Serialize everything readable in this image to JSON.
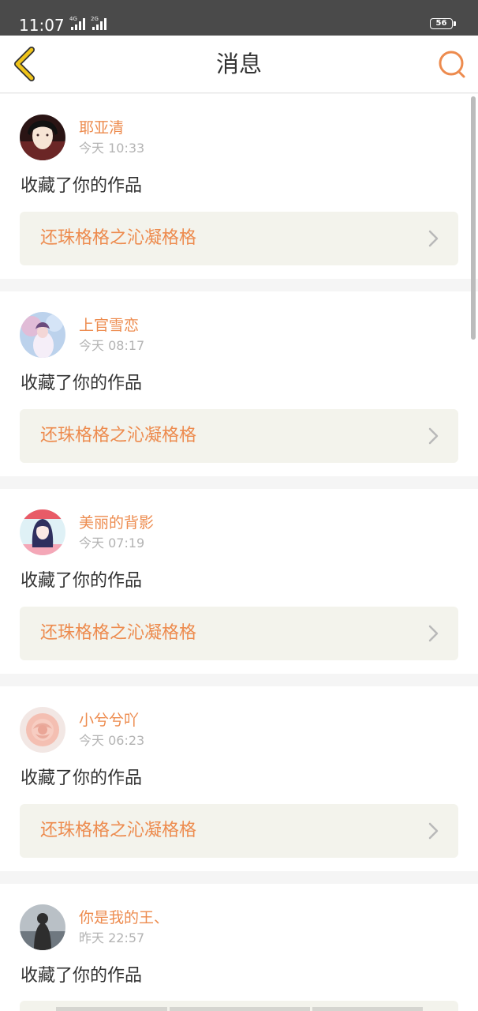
{
  "status_bar": {
    "time": "11:07",
    "network_1": "4G",
    "network_2": "2G",
    "battery": "56"
  },
  "header": {
    "title": "消息",
    "back_icon": "chevron-left-icon",
    "search_icon": "search-icon"
  },
  "colors": {
    "accent": "#ed8b4e",
    "back_icon": "#f0c419",
    "link_background": "#f3f3ec"
  },
  "messages": [
    {
      "user": "耶亚清",
      "time": "今天 10:33",
      "action": "收藏了你的作品",
      "work": "还珠格格之沁凝格格"
    },
    {
      "user": "上官雪恋",
      "time": "今天 08:17",
      "action": "收藏了你的作品",
      "work": "还珠格格之沁凝格格"
    },
    {
      "user": "美丽的背影",
      "time": "今天 07:19",
      "action": "收藏了你的作品",
      "work": "还珠格格之沁凝格格"
    },
    {
      "user": "小兮兮吖",
      "time": "今天 06:23",
      "action": "收藏了你的作品",
      "work": "还珠格格之沁凝格格"
    },
    {
      "user": "你是我的王、",
      "time": "昨天 22:57",
      "action": "收藏了你的作品",
      "work": ""
    }
  ]
}
